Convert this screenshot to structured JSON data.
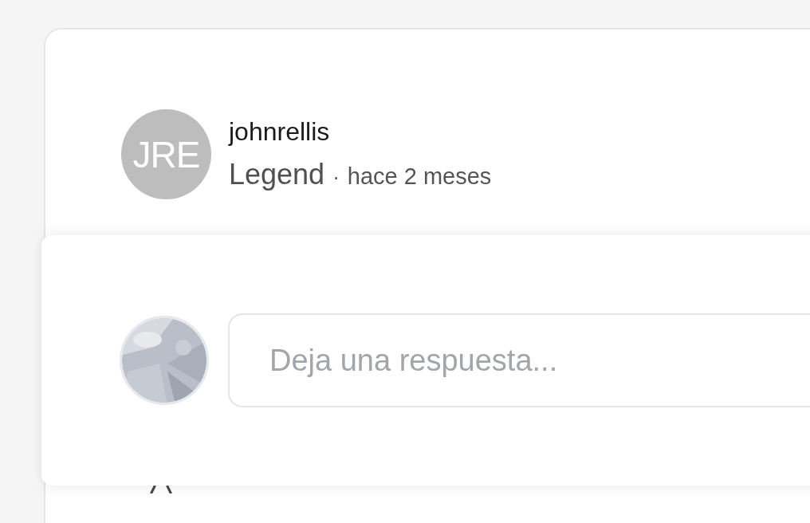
{
  "comment": {
    "avatar": {
      "initials": "JRE"
    },
    "author": "johnrellis",
    "rank": "Legend",
    "separator": "·",
    "time": "hace 2 meses"
  },
  "reply": {
    "placeholder": "Deja una respuesta..."
  }
}
